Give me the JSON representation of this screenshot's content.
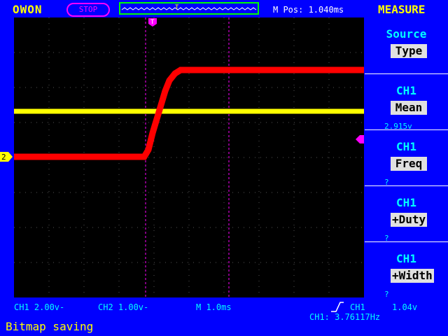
{
  "header": {
    "logo": "OWON",
    "run_state": "STOP",
    "m_pos": "M Pos: 1.040ms",
    "menu_title": "MEASURE"
  },
  "menu": [
    {
      "title": "Source",
      "value": "Type",
      "reading": ""
    },
    {
      "title": "CH1",
      "value": "Mean",
      "reading": "2.915v"
    },
    {
      "title": "CH1",
      "value": "Freq",
      "reading": "?"
    },
    {
      "title": "CH1",
      "value": "+Duty",
      "reading": "?"
    },
    {
      "title": "CH1",
      "value": "+Width",
      "reading": "?"
    }
  ],
  "footer": {
    "ch1_scale": "CH1 2.00v-",
    "ch2_scale": "CH2 1.00v-",
    "timebase": "M 1.0ms",
    "trigger_source": "CH1",
    "trigger_level": "1.04v",
    "ch1_freq": "CH1: 3.76117Hz",
    "status": "Bitmap saving"
  },
  "markers": {
    "ch2": "2",
    "trigger": "T"
  },
  "colors": {
    "background": "#0000ff",
    "screen": "#000000",
    "ch1": "#ffff00",
    "ch2": "#ff0000",
    "accent": "#ff00ff",
    "menu_text": "#00ffff"
  }
}
